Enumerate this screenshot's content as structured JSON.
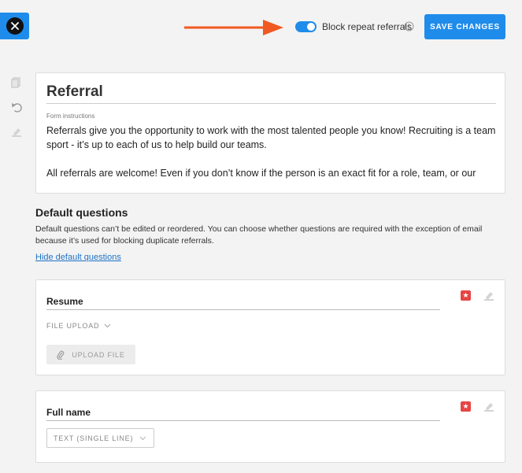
{
  "header": {
    "toggle_label": "Block repeat referrals",
    "toggle_on": true,
    "save_label": "SAVE CHANGES"
  },
  "form": {
    "title": "Referral",
    "instructions_label": "Form instructions",
    "instructions_p1": "Referrals give you the opportunity to work with the most talented people you know! Recruiting is a team sport - it’s up to each of us to help build our teams.",
    "instructions_p2": "All referrals are welcome! Even if you don’t know if the person is an exact fit for a role, team, or our"
  },
  "default_questions": {
    "title": "Default questions",
    "description": "Default questions can’t be edited or reordered. You can choose whether questions are required with the exception of email because it’s used for blocking duplicate referrals.",
    "hide_link": "Hide default questions"
  },
  "questions": [
    {
      "label": "Resume",
      "type": "FILE UPLOAD",
      "upload_label": "UPLOAD FILE"
    },
    {
      "label": "Full name",
      "type": "TEXT (SINGLE LINE)"
    }
  ],
  "colors": {
    "accent": "#1f8ceb",
    "required": "#e64545",
    "arrow": "#f05a22"
  }
}
